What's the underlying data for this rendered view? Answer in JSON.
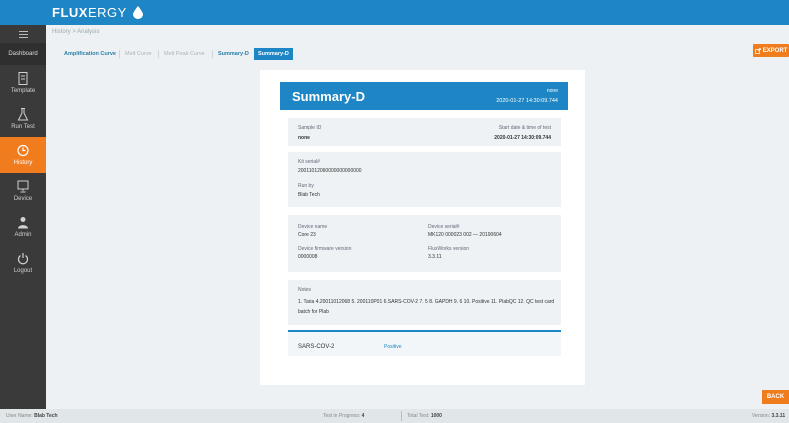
{
  "app": {
    "logo_bold": "FLUX",
    "logo_thin": "ERGY"
  },
  "breadcrumb": "History > Analysis",
  "sidebar": {
    "dashboard": "Dashboard",
    "items": [
      {
        "label": "Template",
        "icon": "document-icon"
      },
      {
        "label": "Run Test",
        "icon": "flask-icon"
      },
      {
        "label": "History",
        "icon": "clock-icon",
        "active": true
      },
      {
        "label": "Device",
        "icon": "monitor-icon"
      },
      {
        "label": "Admin",
        "icon": "user-icon"
      },
      {
        "label": "Logout",
        "icon": "power-icon"
      }
    ]
  },
  "tabs": [
    {
      "label": "Amplification Curve",
      "style": "bold"
    },
    {
      "label": "Melt Curve",
      "style": "muted"
    },
    {
      "label": "Melt Peak Curve",
      "style": "muted"
    },
    {
      "label": "Summary-D",
      "style": "bold"
    },
    {
      "label": "Summary-D",
      "style": "active"
    }
  ],
  "export_label": "EXPORT",
  "report": {
    "title": "Summary-D",
    "header_right_1": "none",
    "header_right_2": "2020-01-27 14:30:09.744",
    "sample_id_label": "Sample ID",
    "sample_id_value": "none",
    "start_label": "Start date & time of test",
    "start_value": "2020-01-27 14:30:09.744",
    "kit_label": "Kit serial#",
    "kit_value": "20011012060000000000000",
    "runby_label": "Run by",
    "runby_value": "Blab Tech",
    "device_name_label": "Device name",
    "device_name_value": "Core 23",
    "device_serial_label": "Device serial#",
    "device_serial_value": "MK120 000023 002 — 20190604",
    "firmware_label": "Device firmware version",
    "firmware_value": "0000008",
    "fluxworks_label": "FluxWorks version",
    "fluxworks_value": "3.3.11",
    "notes_label": "Notes",
    "notes_value": "1. Taria 4.20011012068 5. 200110P01 6.SARS-COV-2 7. 5 8. GAPDH 9. 6 10. Positive 11. PlabQC 12. QC test card batch for Plab",
    "result_name": "SARS-COV-2",
    "result_value": "Positive"
  },
  "back_label": "BACK",
  "status": {
    "user_label": "User Name:",
    "user_value": "Blab Tech",
    "progress_label": "Test in Progress:",
    "progress_value": "4",
    "total_label": "Total Test:",
    "total_value": "1000",
    "version_label": "Version:",
    "version_value": "3.3.11"
  },
  "colors": {
    "primary": "#1e86c4",
    "accent": "#f07c1e",
    "sidebar": "#3a3a3a"
  }
}
